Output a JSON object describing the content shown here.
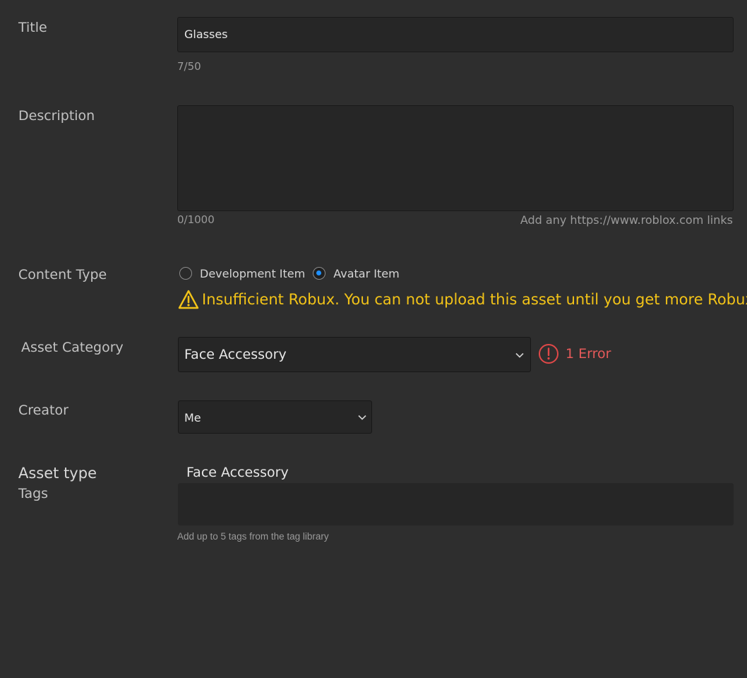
{
  "form": {
    "title": {
      "label": "Title",
      "value": "Glasses",
      "counter": "7/50"
    },
    "description": {
      "label": "Description",
      "value": "",
      "counter": "0/1000",
      "hint": "Add any https://www.roblox.com links"
    },
    "content_type": {
      "label": "Content Type",
      "options": [
        {
          "label": "Development Item",
          "selected": false
        },
        {
          "label": "Avatar Item",
          "selected": true
        }
      ],
      "warning": "Insufficient Robux. You can not upload this asset until you get more Robux."
    },
    "asset_category": {
      "label": "Asset Category",
      "selected": "Face Accessory",
      "error": "1 Error"
    },
    "creator": {
      "label": "Creator",
      "selected": "Me"
    },
    "asset_type": {
      "label": "Asset type",
      "value": "Face Accessory"
    },
    "tags": {
      "label": "Tags",
      "value": "",
      "hint": "Add up to 5 tags from the tag library"
    }
  },
  "colors": {
    "background": "#2e2e2e",
    "input_bg": "#262626",
    "warning": "#f2c318",
    "error": "#e65a5a",
    "radio_selected": "#1e90ff"
  },
  "icons": {
    "warning": "warning-triangle-icon",
    "error": "error-circle-icon",
    "dropdown": "chevron-down-icon"
  }
}
